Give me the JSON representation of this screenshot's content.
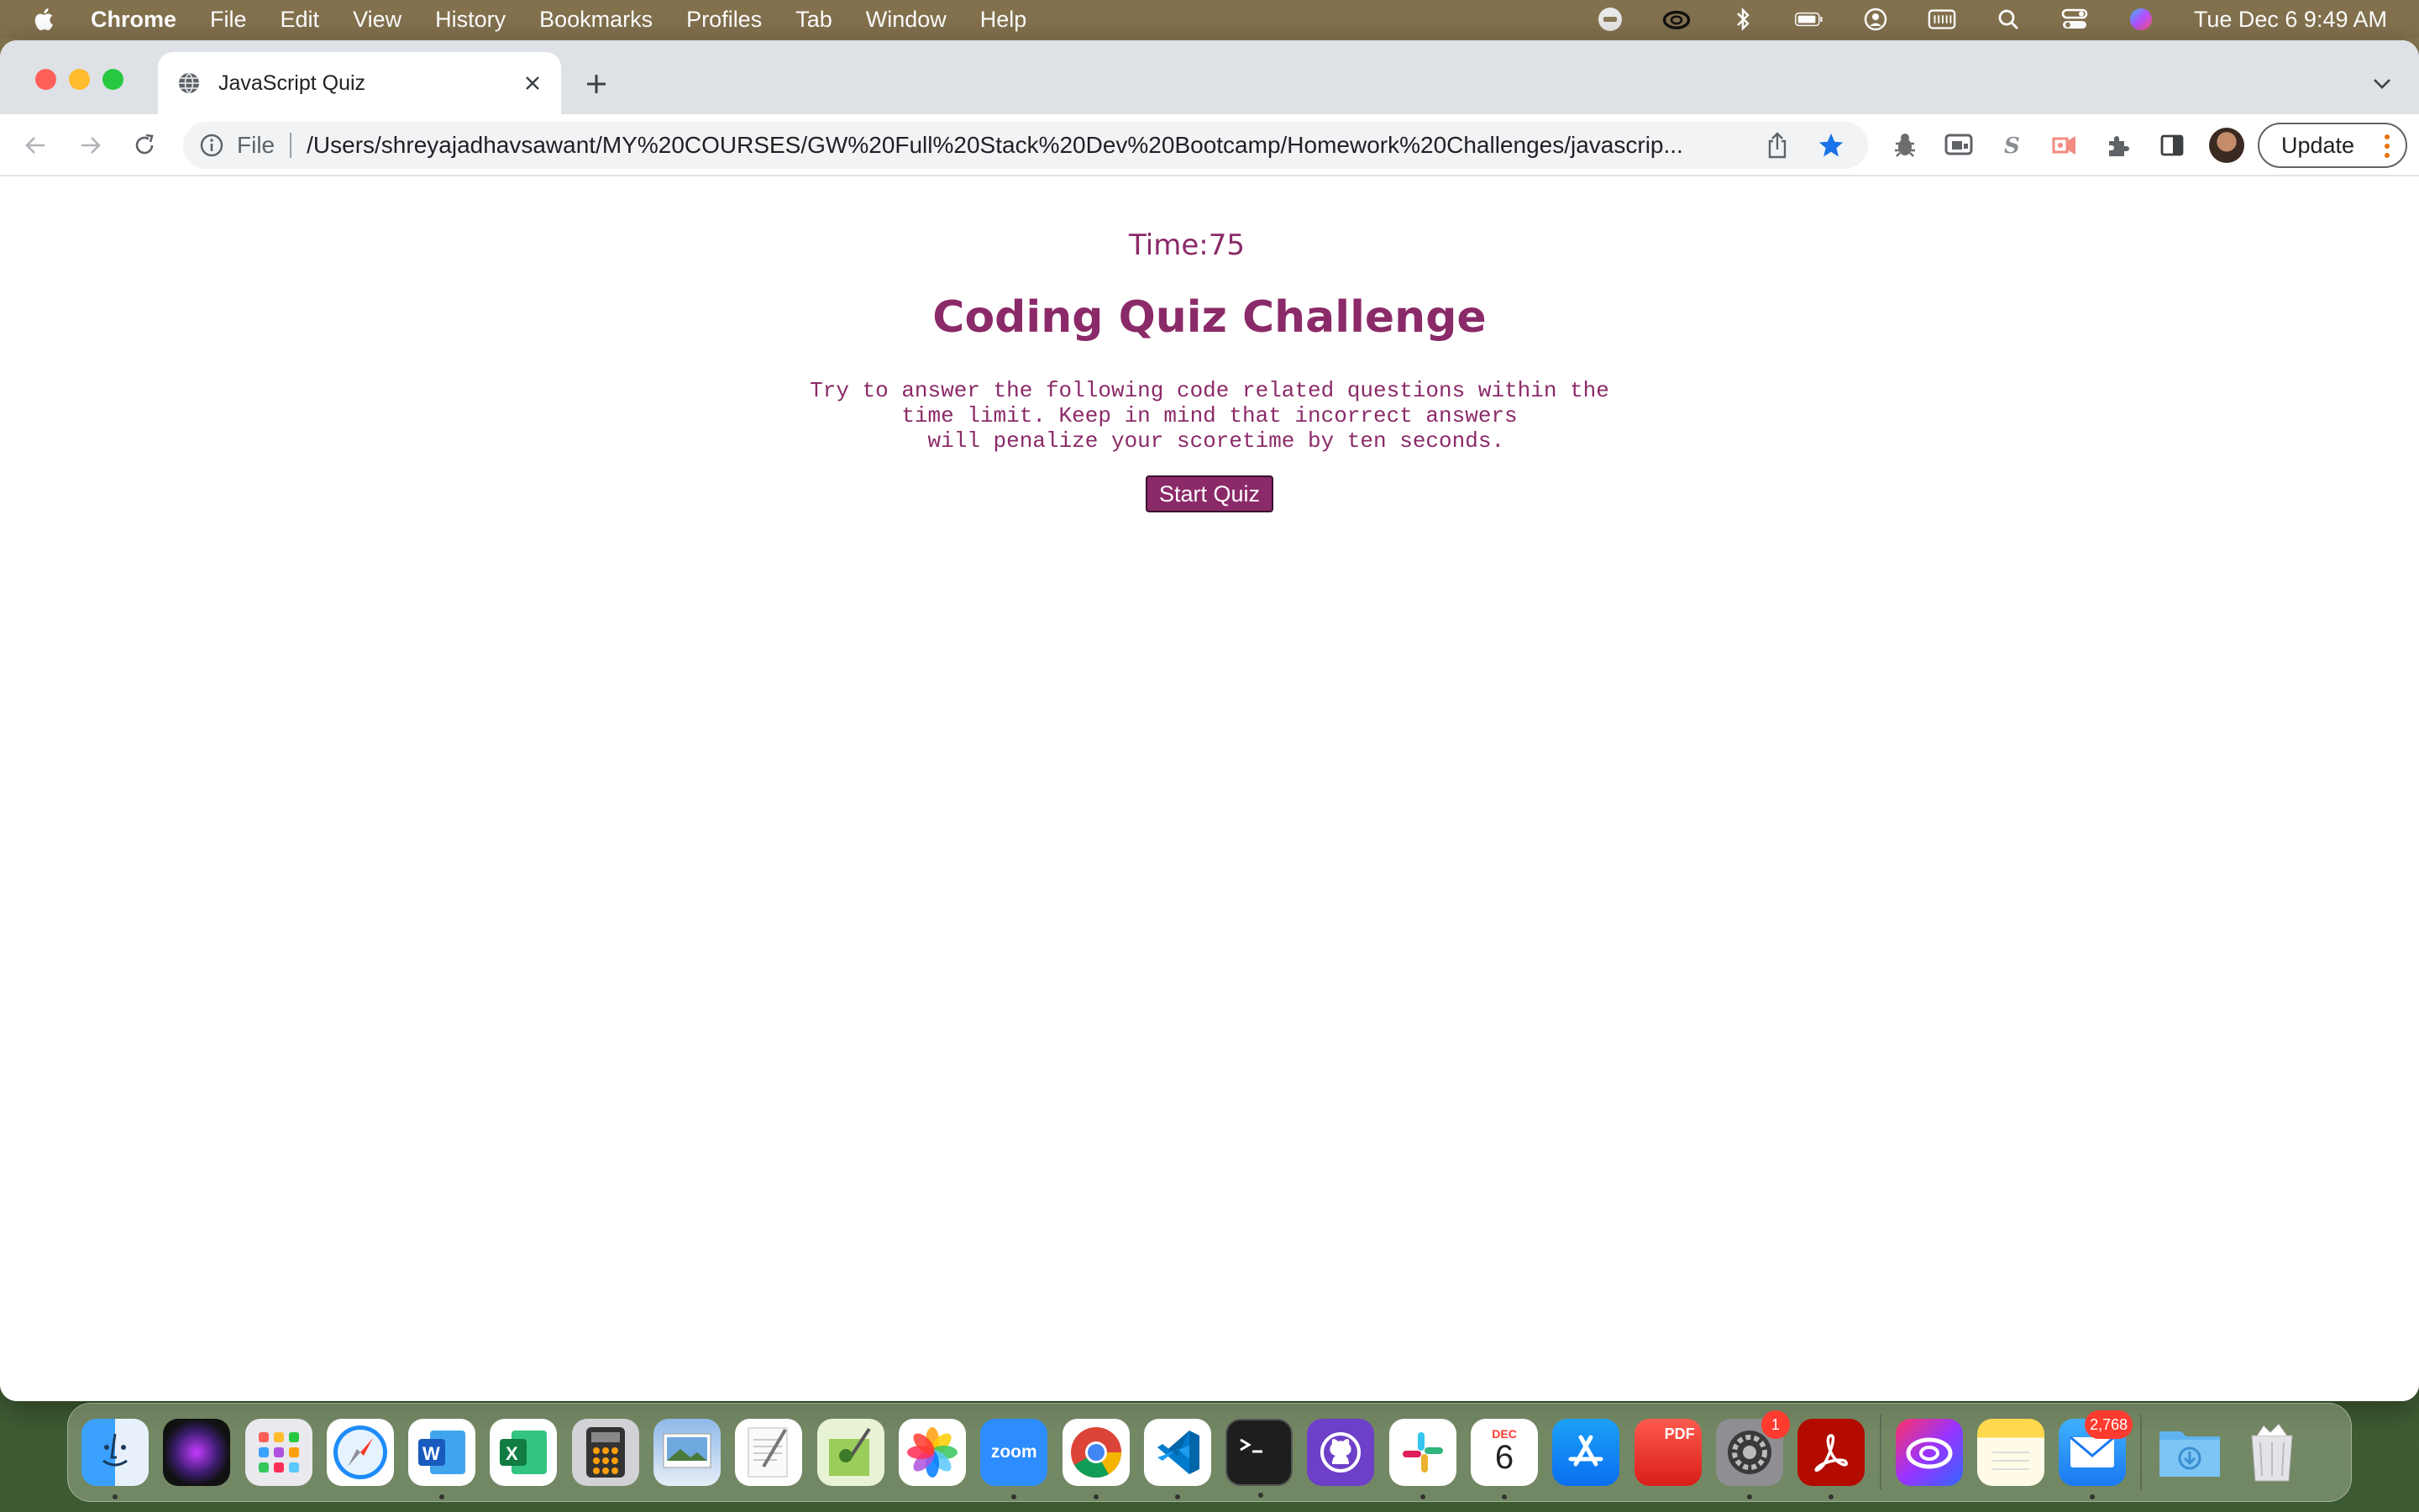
{
  "menubar": {
    "app_name": "Chrome",
    "items": [
      "File",
      "Edit",
      "View",
      "History",
      "Bookmarks",
      "Profiles",
      "Tab",
      "Window",
      "Help"
    ],
    "clock": "Tue Dec 6  9:49 AM",
    "status_icons": [
      "zoom-icon",
      "creative-cloud-icon",
      "bluetooth-icon",
      "battery-icon",
      "user-icon",
      "keyboard-icon",
      "spotlight-icon",
      "control-center-icon",
      "siri-icon"
    ]
  },
  "browser": {
    "tab_title": "JavaScript Quiz",
    "omnibox_scheme": "File",
    "url": "/Users/shreyajadhavsawant/MY%20COURSES/GW%20Full%20Stack%20Dev%20Bootcamp/Homework%20Challenges/javascrip...",
    "update_label": "Update"
  },
  "page": {
    "timer": "Time:75",
    "title": "Coding Quiz Challenge",
    "instructions": "Try to answer the following code related questions within the\ntime limit. Keep in mind that incorrect answers\n will penalize your scoretime by ten seconds.",
    "start_label": "Start Quiz"
  },
  "dock": {
    "calendar_month": "DEC",
    "calendar_day": "6",
    "zoom_label": "zoom",
    "pdf_label": "PDF",
    "settings_badge": "1",
    "mail_badge": "2,768"
  },
  "colors": {
    "accent": "#8b2a68",
    "tabstrip": "#dee1e6"
  }
}
